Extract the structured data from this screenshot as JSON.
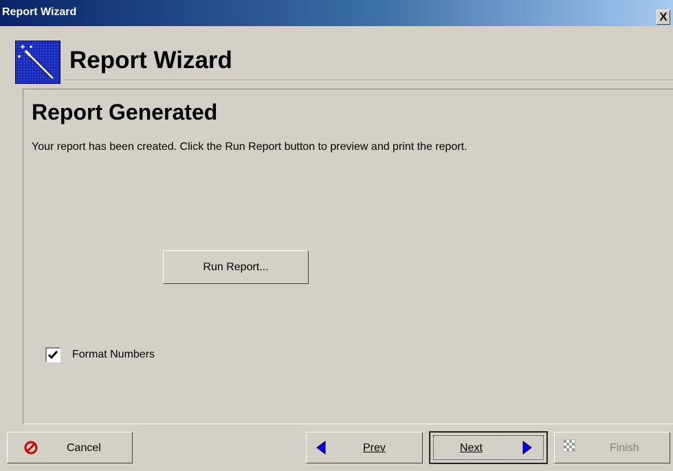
{
  "window": {
    "title": "Report Wizard",
    "close_label": "X"
  },
  "header": {
    "title": "Report Wizard",
    "icon": "magic-wand-icon"
  },
  "page": {
    "heading": "Report Generated",
    "description": "Your report has been created.  Click the Run Report button to preview and print the report.",
    "run_report_label": "Run Report...",
    "format_numbers_label": "Format Numbers",
    "format_numbers_checked": true
  },
  "footer": {
    "cancel_label": "Cancel",
    "prev_label": "Prev",
    "next_label": "Next",
    "finish_label": "Finish",
    "finish_enabled": false
  },
  "colors": {
    "face": "#d4d0c8",
    "title_gradient_start": "#0a246a",
    "title_gradient_end": "#a6caf0",
    "arrow_blue": "#0000ff",
    "cancel_red": "#cc0000",
    "disabled_text": "#808080"
  }
}
